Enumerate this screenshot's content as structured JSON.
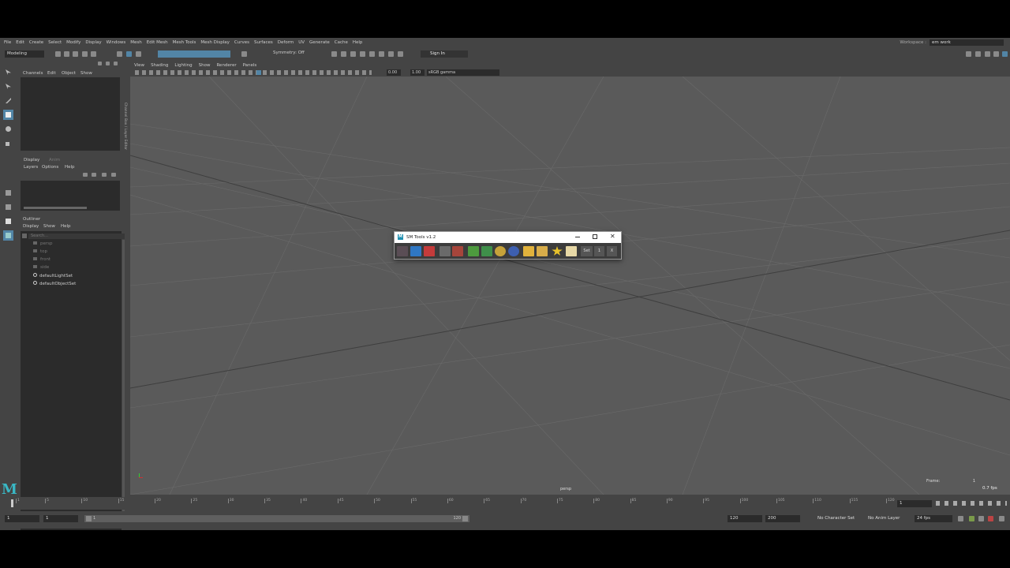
{
  "menubar": {
    "items": [
      "File",
      "Edit",
      "Create",
      "Select",
      "Modify",
      "Display",
      "Windows",
      "Mesh",
      "Edit Mesh",
      "Mesh Tools",
      "Mesh Display",
      "Curves",
      "Surfaces",
      "Deform",
      "UV",
      "Generate",
      "Cache",
      "Help"
    ],
    "workspace_label": "Workspace :",
    "workspace_value": "em work"
  },
  "statusline": {
    "mode": "Modeling",
    "symmetry": "Symmetry: Off",
    "sign_in": "Sign In"
  },
  "channelbox": {
    "tabs": [
      "Channels",
      "Edit",
      "Object",
      "Show"
    ],
    "vertical_label": "Channel Box / Layer Editor"
  },
  "layers": {
    "tabs": [
      "Display",
      "Anim"
    ],
    "menu": [
      "Layers",
      "Options",
      "Help"
    ]
  },
  "outliner": {
    "title": "Outliner",
    "menu": [
      "Display",
      "Show",
      "Help"
    ],
    "search_placeholder": "Search...",
    "items": [
      {
        "label": "persp",
        "dim": true
      },
      {
        "label": "top",
        "dim": true
      },
      {
        "label": "front",
        "dim": true
      },
      {
        "label": "side",
        "dim": true
      },
      {
        "label": "defaultLightSet",
        "dim": false
      },
      {
        "label": "defaultObjectSet",
        "dim": false
      }
    ]
  },
  "viewport": {
    "menu": [
      "View",
      "Shading",
      "Lighting",
      "Show",
      "Renderer",
      "Panels"
    ],
    "field_a": "0.00",
    "field_b": "1.00",
    "color_space": "sRGB gamma",
    "camera": "persp",
    "hud_frame_label": "Frame:",
    "hud_frame_value": "1",
    "hud_fps": "0.7 fps"
  },
  "dialog": {
    "title": "SM Tools v1.2",
    "btn_set": "Set",
    "btn_one": "1",
    "btn_x": "X"
  },
  "timeline": {
    "ticks": [
      "1",
      "5",
      "10",
      "15",
      "20",
      "25",
      "30",
      "35",
      "40",
      "45",
      "50",
      "55",
      "60",
      "65",
      "70",
      "75",
      "80",
      "85",
      "90",
      "95",
      "100",
      "105",
      "110",
      "115",
      "120"
    ],
    "current_frame": "1"
  },
  "range": {
    "start": "1",
    "playback_start": "1",
    "slider_start": "1",
    "slider_end": "120",
    "playback_end": "120",
    "end": "200",
    "character_set": "No Character Set",
    "anim_layer": "No Anim Layer",
    "fps": "24 fps"
  },
  "colors": {
    "selected_tool": "#5285a6",
    "maya_logo": "#39b7c4"
  }
}
